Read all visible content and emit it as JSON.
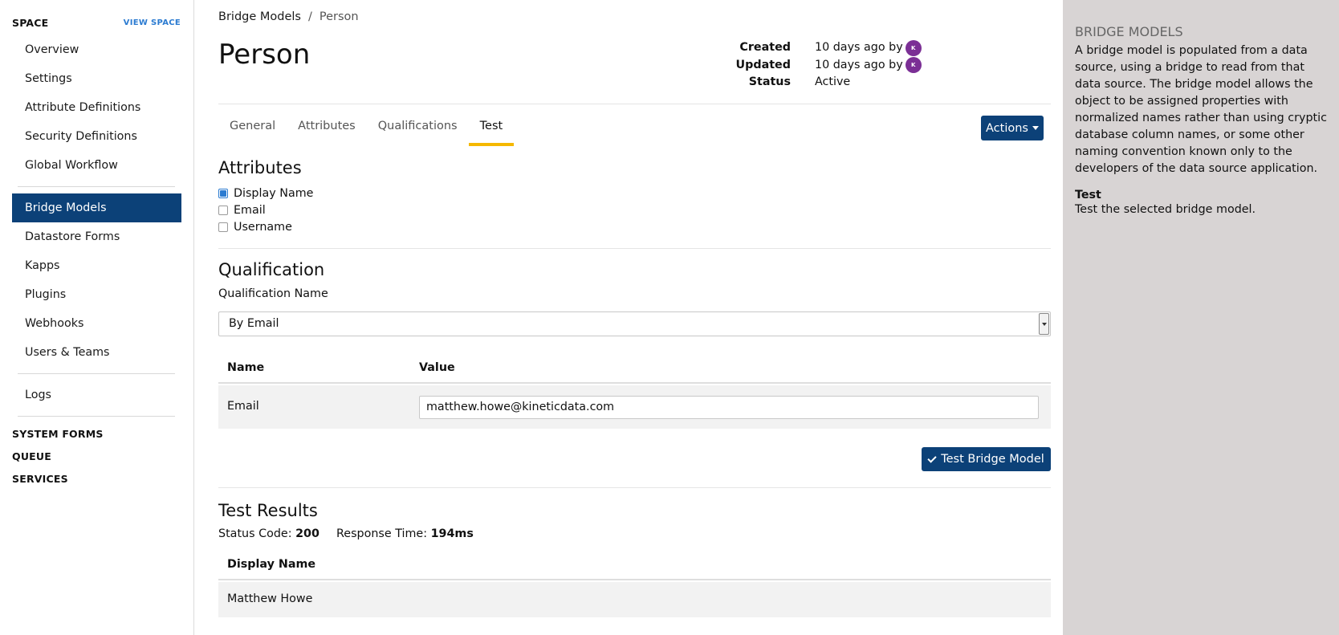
{
  "sidebar": {
    "section_title": "SPACE",
    "view_space_link": "VIEW SPACE",
    "items": [
      {
        "label": "Overview"
      },
      {
        "label": "Settings"
      },
      {
        "label": "Attribute Definitions"
      },
      {
        "label": "Security Definitions"
      },
      {
        "label": "Global Workflow"
      },
      {
        "label": "Bridge Models"
      },
      {
        "label": "Datastore Forms"
      },
      {
        "label": "Kapps"
      },
      {
        "label": "Plugins"
      },
      {
        "label": "Webhooks"
      },
      {
        "label": "Users & Teams"
      },
      {
        "label": "Logs"
      }
    ],
    "active_item": "Bridge Models",
    "sections": [
      {
        "label": "SYSTEM FORMS"
      },
      {
        "label": "QUEUE"
      },
      {
        "label": "SERVICES"
      }
    ]
  },
  "breadcrumb": {
    "parent": "Bridge Models",
    "separator": "/",
    "current": "Person"
  },
  "page": {
    "title": "Person",
    "meta": {
      "created_label": "Created",
      "created_value": "10 days ago by",
      "updated_label": "Updated",
      "updated_value": "10 days ago by",
      "status_label": "Status",
      "status_value": "Active",
      "avatar_initial": "K"
    }
  },
  "tabs": [
    {
      "label": "General"
    },
    {
      "label": "Attributes"
    },
    {
      "label": "Qualifications"
    },
    {
      "label": "Test"
    }
  ],
  "active_tab": "Test",
  "actions_button": "Actions",
  "attributes": {
    "heading": "Attributes",
    "items": [
      {
        "label": "Display Name",
        "checked": true
      },
      {
        "label": "Email",
        "checked": false
      },
      {
        "label": "Username",
        "checked": false
      }
    ]
  },
  "qualification": {
    "heading": "Qualification",
    "name_label": "Qualification Name",
    "selected": "By Email",
    "table": {
      "headers": [
        "Name",
        "Value"
      ],
      "rows": [
        {
          "name": "Email",
          "value": "matthew.howe@kineticdata.com"
        }
      ]
    }
  },
  "test_button": "Test Bridge Model",
  "results": {
    "heading": "Test Results",
    "status_code_label": "Status Code:",
    "status_code": "200",
    "response_time_label": "Response Time:",
    "response_time": "194ms",
    "headers": [
      "Display Name"
    ],
    "rows": [
      [
        "Matthew Howe"
      ]
    ]
  },
  "help": {
    "title": "Bridge Models",
    "description": "A bridge model is populated from a data source, using a bridge to read from that data source. The bridge model allows the object to be assigned properties with normalized names rather than using cryptic database column names, or some other naming convention known only to the developers of the data source application.",
    "sub_title": "Test",
    "sub_text": "Test the selected bridge model."
  },
  "colors": {
    "primary": "#0c4178",
    "tab_accent": "#f5b800",
    "avatar": "#7b2f95",
    "link": "#2b7bd1",
    "help_bg": "#d8d4d4"
  }
}
